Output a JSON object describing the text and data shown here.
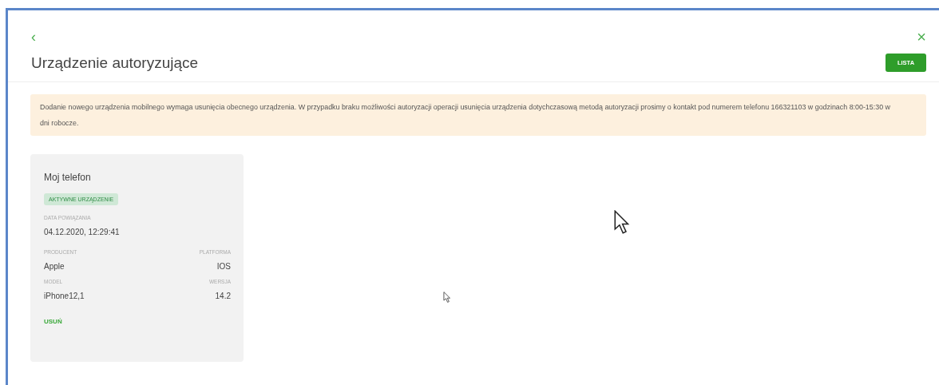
{
  "header": {
    "back": "‹",
    "close": "×",
    "title": "Urządzenie autoryzujące",
    "list_button": "LISTA"
  },
  "notice": "Dodanie nowego urządzenia mobilnego wymaga usunięcia obecnego urządzenia. W przypadku braku możliwości autoryzacji operacji usunięcia urządzenia dotychczasową metodą autoryzacji prosimy o kontakt pod numerem telefonu 166321103 w godzinach 8:00-15:30 w dni robocze.",
  "devices": [
    {
      "name": "Moj telefon",
      "status": "AKTYWNE URZĄDZENIE",
      "date_label": "DATA POWIĄZANIA",
      "date": "04.12.2020, 12:29:41",
      "fields": [
        {
          "label": "PRODUCENT",
          "value": "Apple"
        },
        {
          "label": "PLATFORMA",
          "value": "IOS"
        },
        {
          "label": "MODEL",
          "value": "iPhone12,1"
        },
        {
          "label": "WERSJA",
          "value": "14.2"
        }
      ],
      "remove": "USUŃ"
    }
  ]
}
